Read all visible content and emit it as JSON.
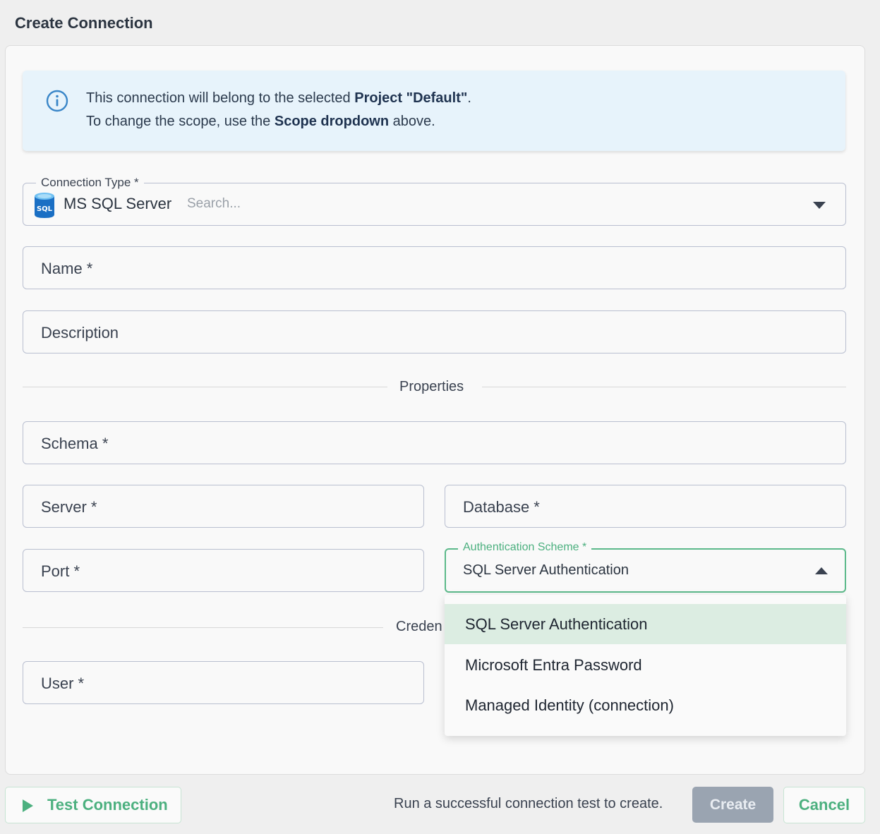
{
  "dialog": {
    "title": "Create Connection"
  },
  "info": {
    "line1_prefix": "This connection will belong to the selected ",
    "line1_bold": "Project \"Default\"",
    "line1_suffix": ".",
    "line2_prefix": "To change the scope, use the ",
    "line2_bold": "Scope dropdown",
    "line2_suffix": " above."
  },
  "connection_type": {
    "legend": "Connection Type *",
    "value": "MS SQL Server",
    "search_placeholder": "Search...",
    "icon": "sql-database-icon",
    "icon_text": "SQL"
  },
  "fields": {
    "name": "Name *",
    "description": "Description",
    "schema": "Schema *",
    "server": "Server *",
    "database": "Database *",
    "port": "Port *",
    "user": "User *"
  },
  "sections": {
    "properties": "Properties",
    "credentials_partial": "Creden"
  },
  "auth_scheme": {
    "legend": "Authentication Scheme *",
    "value": "SQL Server Authentication",
    "options": [
      "SQL Server Authentication",
      "Microsoft Entra Password",
      "Managed Identity (connection)"
    ],
    "selected_index": 0
  },
  "footer": {
    "test_label": "Test Connection",
    "hint": "Run a successful connection test to create.",
    "create_label": "Create",
    "cancel_label": "Cancel"
  },
  "colors": {
    "accent_green": "#4cb07f",
    "info_bg": "#e7f3fb",
    "selected_bg": "#dcede2",
    "disabled_button": "#9aa4b1",
    "info_icon": "#3a86c8"
  }
}
